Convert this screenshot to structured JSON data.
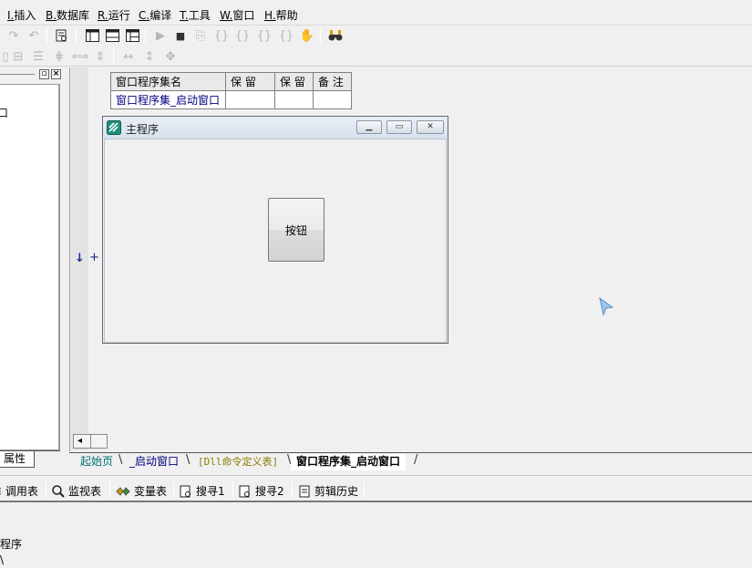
{
  "menu": [
    {
      "key": "I.",
      "label": "插入"
    },
    {
      "key": "B.",
      "label": "数据库"
    },
    {
      "key": "R.",
      "label": "运行"
    },
    {
      "key": "C.",
      "label": "编译"
    },
    {
      "key": "T.",
      "label": "工具"
    },
    {
      "key": "W.",
      "label": "窗口"
    },
    {
      "key": "H.",
      "label": "帮助"
    }
  ],
  "left_panel": {
    "partial_text": "口",
    "property_tab": "属性"
  },
  "assembly_table": {
    "headers": [
      "窗口程序集名",
      "保 留",
      "保 留",
      "备 注"
    ],
    "row": [
      "窗口程序集_启动窗口",
      "",
      "",
      ""
    ]
  },
  "form_window": {
    "title": "主程序",
    "button_label": "按钮"
  },
  "gutter_marks": {
    "arrow": "↓",
    "plus": "+"
  },
  "doc_tabs": [
    "起始页",
    "_启动窗口",
    "[Dll命令定义表]",
    "窗口程序集_启动窗口"
  ],
  "bottom_tabs": [
    "调用表",
    "监视表",
    "变量表",
    "搜寻1",
    "搜寻2",
    "剪辑历史"
  ],
  "output_lines": [
    "程序",
    "\\"
  ],
  "colors": {
    "link_teal": "#006f6f",
    "table_row_text": "#000080",
    "dll_tab_text": "#8a7a00"
  }
}
